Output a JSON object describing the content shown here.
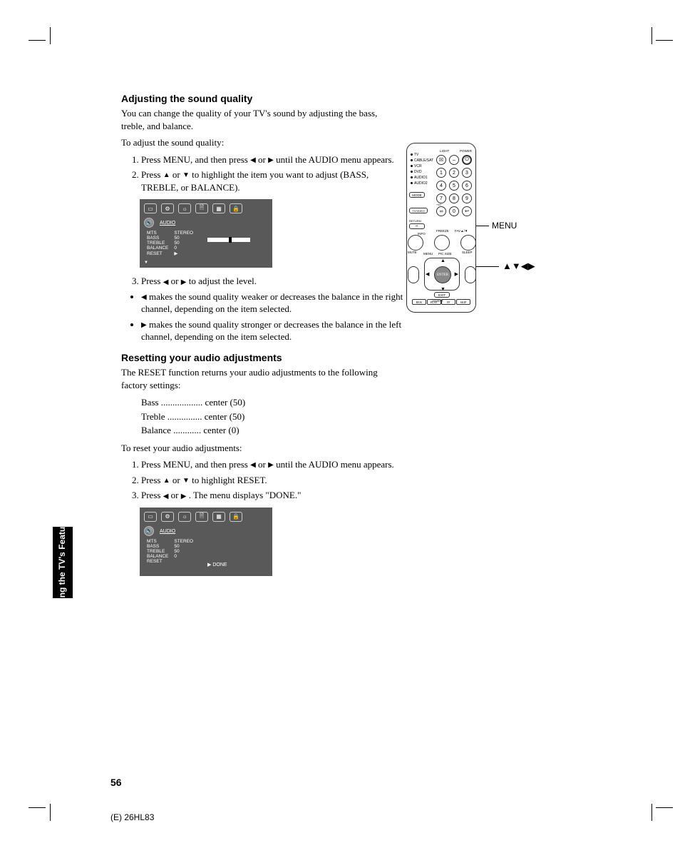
{
  "headings": {
    "h1": "Adjusting the sound quality",
    "h2": "Resetting your audio adjustments"
  },
  "body": {
    "intro1": "You can change the quality of your TV's sound by adjusting the bass, treble, and balance.",
    "intro2": "To adjust the sound quality:",
    "step1a": "Press MENU, and then press",
    "step1b": "or",
    "step1c": "until the AUDIO menu appears.",
    "step2a": "Press",
    "step2b": "or",
    "step2c": "to highlight the item you want to adjust (BASS, TREBLE, or BALANCE).",
    "step3a": "Press",
    "step3b": "or",
    "step3c": "to adjust the level.",
    "bullet1a": "makes the sound quality weaker or decreases the balance in the right channel, depending on the item selected.",
    "bullet2a": "makes the sound quality stronger or decreases the balance in the left channel, depending on the item selected.",
    "reset_intro": "The RESET function returns your audio adjustments to the following factory settings:",
    "bass_default": "Bass ..................  center (50)",
    "treble_default": "Treble ...............  center (50)",
    "balance_default": "Balance ............  center (0)",
    "reset_to": "To reset your audio adjustments:",
    "rstep2a": "Press",
    "rstep2b": "or",
    "rstep2c": "to highlight RESET.",
    "rstep3a": "Press",
    "rstep3b": "or",
    "rstep3c": ". The menu displays \"DONE.\""
  },
  "osd": {
    "title": "AUDIO",
    "rows": {
      "mts": "MTS",
      "mts_v": "STEREO",
      "bass": "BASS",
      "bass_v": "50",
      "treble": "TREBLE",
      "treble_v": "50",
      "balance": "BALANCE",
      "balance_v": "0",
      "reset": "RESET",
      "done": "DONE"
    }
  },
  "remote": {
    "devices": [
      "TV",
      "CABLE/SAT",
      "VCR",
      "DVD",
      "AUDIO1",
      "AUDIO2"
    ],
    "mode": "MODE",
    "light": "LIGHT",
    "power": "POWER",
    "tvvideo": "TV/VDEO",
    "fav": "FAV",
    "return": "RETURN",
    "info": "INFO",
    "enter": "ENTER",
    "exit": "EXIT",
    "menu": "MENU",
    "picsize": "PIC SIZE",
    "mute": "MUTE",
    "sleep": "SLEEP",
    "freeze": "FREEZE",
    "favplusminus": "FAV▲/▼"
  },
  "callouts": {
    "menu": "MENU",
    "arrows": "▲▼◀▶"
  },
  "section_tab": "Using the TV's\nFeatures",
  "page_number": "56",
  "footer": "(E) 26HL83",
  "chart_data": null
}
